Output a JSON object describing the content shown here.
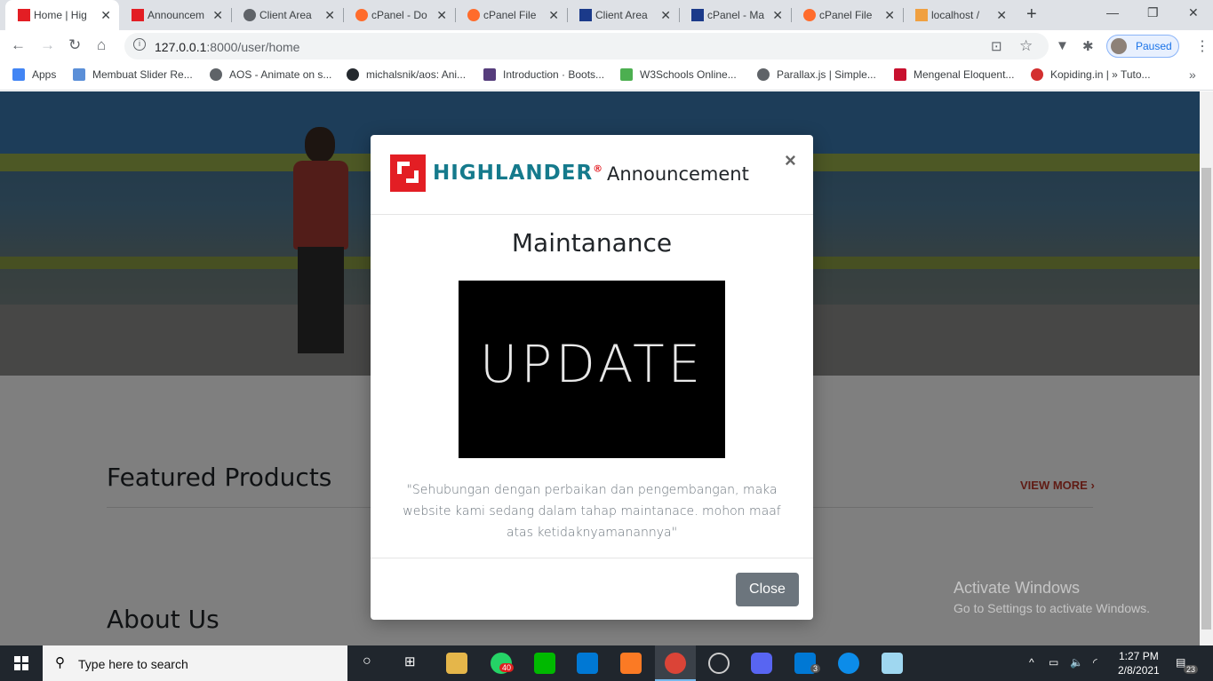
{
  "tabs": [
    {
      "label": "Home | Hig",
      "favicon": "highlander-icon",
      "active": true
    },
    {
      "label": "Announcem",
      "favicon": "highlander-icon"
    },
    {
      "label": "Client Area",
      "favicon": "globe-icon"
    },
    {
      "label": "cPanel - Do",
      "favicon": "cpanel-icon"
    },
    {
      "label": "cPanel File",
      "favicon": "cpanel-icon"
    },
    {
      "label": "Client Area",
      "favicon": "n-icon"
    },
    {
      "label": "cPanel - Ma",
      "favicon": "n-icon"
    },
    {
      "label": "cPanel File",
      "favicon": "cpanel-icon"
    },
    {
      "label": "localhost /",
      "favicon": "pma-icon"
    }
  ],
  "address": {
    "host": "127.0.0.1",
    "path": ":8000/user/home"
  },
  "profile": {
    "label": "Paused"
  },
  "bookmarks": [
    {
      "label": "Apps",
      "color": "#4285f4"
    },
    {
      "label": "Membuat Slider Re...",
      "color": "#5b8fd8"
    },
    {
      "label": "AOS - Animate on s...",
      "color": "#5f6368"
    },
    {
      "label": "michalsnik/aos: Ani...",
      "color": "#24292e"
    },
    {
      "label": "Introduction · Boots...",
      "color": "#563d7c"
    },
    {
      "label": "W3Schools Online...",
      "color": "#4caf50"
    },
    {
      "label": "Parallax.js | Simple...",
      "color": "#5f6368"
    },
    {
      "label": "Mengenal Eloquent...",
      "color": "#c8102e"
    },
    {
      "label": "Kopiding.in | » Tuto...",
      "color": "#d32f2f"
    }
  ],
  "page": {
    "featured_title": "Featured Products",
    "view_more": "VIEW MORE ›",
    "about_title": "About Us"
  },
  "watermark": {
    "line1": "Activate Windows",
    "line2": "Go to Settings to activate Windows."
  },
  "modal": {
    "brand": "HIGHLANDER",
    "brand_mark": "®",
    "header_title": "Announcement",
    "close_x": "×",
    "title": "Maintanance",
    "image_text": "UPDATE",
    "message": "\"Sehubungan dengan perbaikan dan pengembangan, maka website kami sedang dalam tahap maintanace. mohon maaf atas ketidaknyamanannya\"",
    "close_button": "Close"
  },
  "taskbar": {
    "search_placeholder": "Type here to search",
    "whatsapp_badge": "40",
    "mail_badge": "3",
    "notif_count": "23",
    "time": "1:27 PM",
    "date": "2/8/2021"
  }
}
